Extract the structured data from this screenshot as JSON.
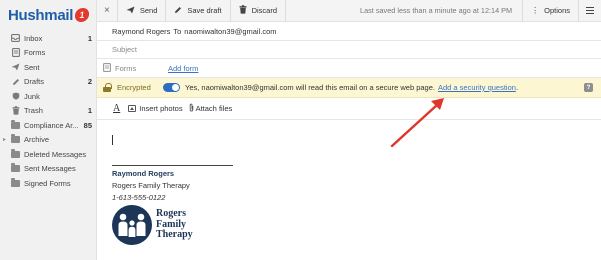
{
  "brand": {
    "name": "Hushmail",
    "badge": "1"
  },
  "sidebar": {
    "folders": [
      {
        "label": "Inbox",
        "count": "1",
        "icon": "inbox-icon"
      },
      {
        "label": "Forms",
        "count": "",
        "icon": "forms-icon"
      },
      {
        "label": "Sent",
        "count": "",
        "icon": "sent-icon"
      },
      {
        "label": "Drafts",
        "count": "2",
        "icon": "drafts-icon"
      },
      {
        "label": "Junk",
        "count": "",
        "icon": "junk-icon"
      },
      {
        "label": "Trash",
        "count": "1",
        "icon": "trash-icon"
      },
      {
        "label": "Compliance Ar...",
        "count": "85",
        "icon": "folder-icon"
      },
      {
        "label": "Archive",
        "count": "",
        "icon": "folder-icon"
      },
      {
        "label": "Deleted Messages",
        "count": "",
        "icon": "folder-icon"
      },
      {
        "label": "Sent Messages",
        "count": "",
        "icon": "folder-icon"
      },
      {
        "label": "Signed Forms",
        "count": "",
        "icon": "folder-icon"
      }
    ]
  },
  "toolbar": {
    "send": "Send",
    "save_draft": "Save draft",
    "discard": "Discard",
    "last_saved": "Last saved less than a minute ago at 12:14 PM",
    "options": "Options",
    "close": "×"
  },
  "compose": {
    "from": "Raymond Rogers",
    "to_label": "To",
    "to_value": "naomiwalton39@gmail.com",
    "subject_placeholder": "Subject",
    "forms_label": "Forms",
    "add_form": "Add form",
    "encrypted_label": "Encrypted",
    "encrypted_on": true,
    "encrypted_message": "Yes, naomiwalton39@gmail.com will read this email on a secure web page.",
    "security_question_link": "Add a security question",
    "security_question_suffix": ".",
    "help": "?",
    "format_text": "A",
    "insert_photos": "Insert photos",
    "attach_files": "Attach files"
  },
  "signature": {
    "name": "Raymond Rogers",
    "company": "Rogers Family Therapy",
    "phone": "1-613-555-0122",
    "logo_lines": [
      "Rogers",
      "Family",
      "Therapy"
    ]
  },
  "colors": {
    "brand_blue": "#1f5fa8",
    "brand_red": "#e23a2d",
    "link": "#3a73c4",
    "toggle_on": "#2b6ec1",
    "encrypted_bg": "#fdf6d3",
    "arrow": "#e0352b",
    "signature_navy": "#1d3557"
  }
}
